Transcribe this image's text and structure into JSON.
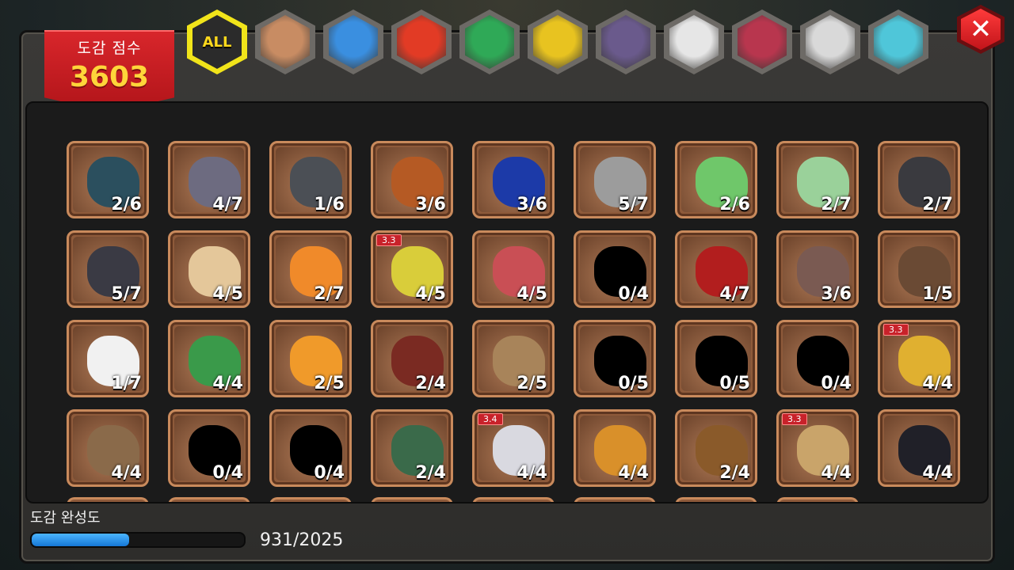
{
  "score": {
    "label": "도감 점수",
    "value": "3603"
  },
  "tabs": [
    {
      "id": "all",
      "label": "ALL",
      "icon": "all-icon",
      "color": "#2b2b2b",
      "active": true
    },
    {
      "id": "earth",
      "label": "",
      "icon": "earth-element-icon",
      "color": "#c88c63"
    },
    {
      "id": "water",
      "label": "",
      "icon": "water-element-icon",
      "color": "#3a8fe0"
    },
    {
      "id": "fire",
      "label": "",
      "icon": "fire-element-icon",
      "color": "#e23b25"
    },
    {
      "id": "wind",
      "label": "",
      "icon": "wind-element-icon",
      "color": "#2fa957"
    },
    {
      "id": "light",
      "label": "",
      "icon": "light-element-icon",
      "color": "#e8c320"
    },
    {
      "id": "dark",
      "label": "",
      "icon": "dark-element-icon",
      "color": "#6a5a8c"
    },
    {
      "id": "metal",
      "label": "",
      "icon": "metal-element-icon",
      "color": "#e6e6e6"
    },
    {
      "id": "chaos",
      "label": "",
      "icon": "chaos-element-icon",
      "color": "#b8364e"
    },
    {
      "id": "void",
      "label": "",
      "icon": "void-element-icon",
      "color": "#d9d9d9"
    },
    {
      "id": "rainbow",
      "label": "",
      "icon": "rainbow-element-icon",
      "color": "#4fc6d9"
    }
  ],
  "cards": [
    {
      "count": "2/6",
      "color": "#2b4f5e"
    },
    {
      "count": "4/7",
      "color": "#6d6b80"
    },
    {
      "count": "1/6",
      "color": "#4b4f55"
    },
    {
      "count": "3/6",
      "color": "#b55a24"
    },
    {
      "count": "3/6",
      "color": "#1c3aa8"
    },
    {
      "count": "5/7",
      "color": "#9c9c9c"
    },
    {
      "count": "2/6",
      "color": "#6fc76a"
    },
    {
      "count": "2/7",
      "color": "#9ad19a"
    },
    {
      "count": "2/7",
      "color": "#3a3a3f"
    },
    {
      "count": "5/7",
      "color": "#3a3a44"
    },
    {
      "count": "4/5",
      "color": "#e4c79a"
    },
    {
      "count": "2/7",
      "color": "#f08a2a"
    },
    {
      "count": "4/5",
      "color": "#d9cd3a",
      "version": "3.3"
    },
    {
      "count": "4/5",
      "color": "#c94f55"
    },
    {
      "count": "0/4",
      "color": "#000000"
    },
    {
      "count": "4/7",
      "color": "#b21e1e"
    },
    {
      "count": "3/6",
      "color": "#7a5a52"
    },
    {
      "count": "1/5",
      "color": "#6a4a34"
    },
    {
      "count": "1/7",
      "color": "#f1f1f1"
    },
    {
      "count": "4/4",
      "color": "#3a9a4a"
    },
    {
      "count": "2/5",
      "color": "#f09a2a"
    },
    {
      "count": "2/4",
      "color": "#7a2a22"
    },
    {
      "count": "2/5",
      "color": "#a8845a"
    },
    {
      "count": "0/5",
      "color": "#000000"
    },
    {
      "count": "0/5",
      "color": "#000000"
    },
    {
      "count": "0/4",
      "color": "#000000"
    },
    {
      "count": "4/4",
      "color": "#e0b030",
      "version": "3.3"
    },
    {
      "count": "4/4",
      "color": "#8a6a4a"
    },
    {
      "count": "0/4",
      "color": "#000000"
    },
    {
      "count": "0/4",
      "color": "#000000"
    },
    {
      "count": "2/4",
      "color": "#3a6a4a"
    },
    {
      "count": "4/4",
      "color": "#d9d9e0",
      "version": "3.4"
    },
    {
      "count": "4/4",
      "color": "#d9902a"
    },
    {
      "count": "2/4",
      "color": "#8a5a2a"
    },
    {
      "count": "4/4",
      "color": "#c9a46a",
      "version": "3.3"
    },
    {
      "count": "4/4",
      "color": "#202028"
    }
  ],
  "completion": {
    "label": "도감 완성도",
    "value": "931/2025",
    "progress": 0.46
  }
}
